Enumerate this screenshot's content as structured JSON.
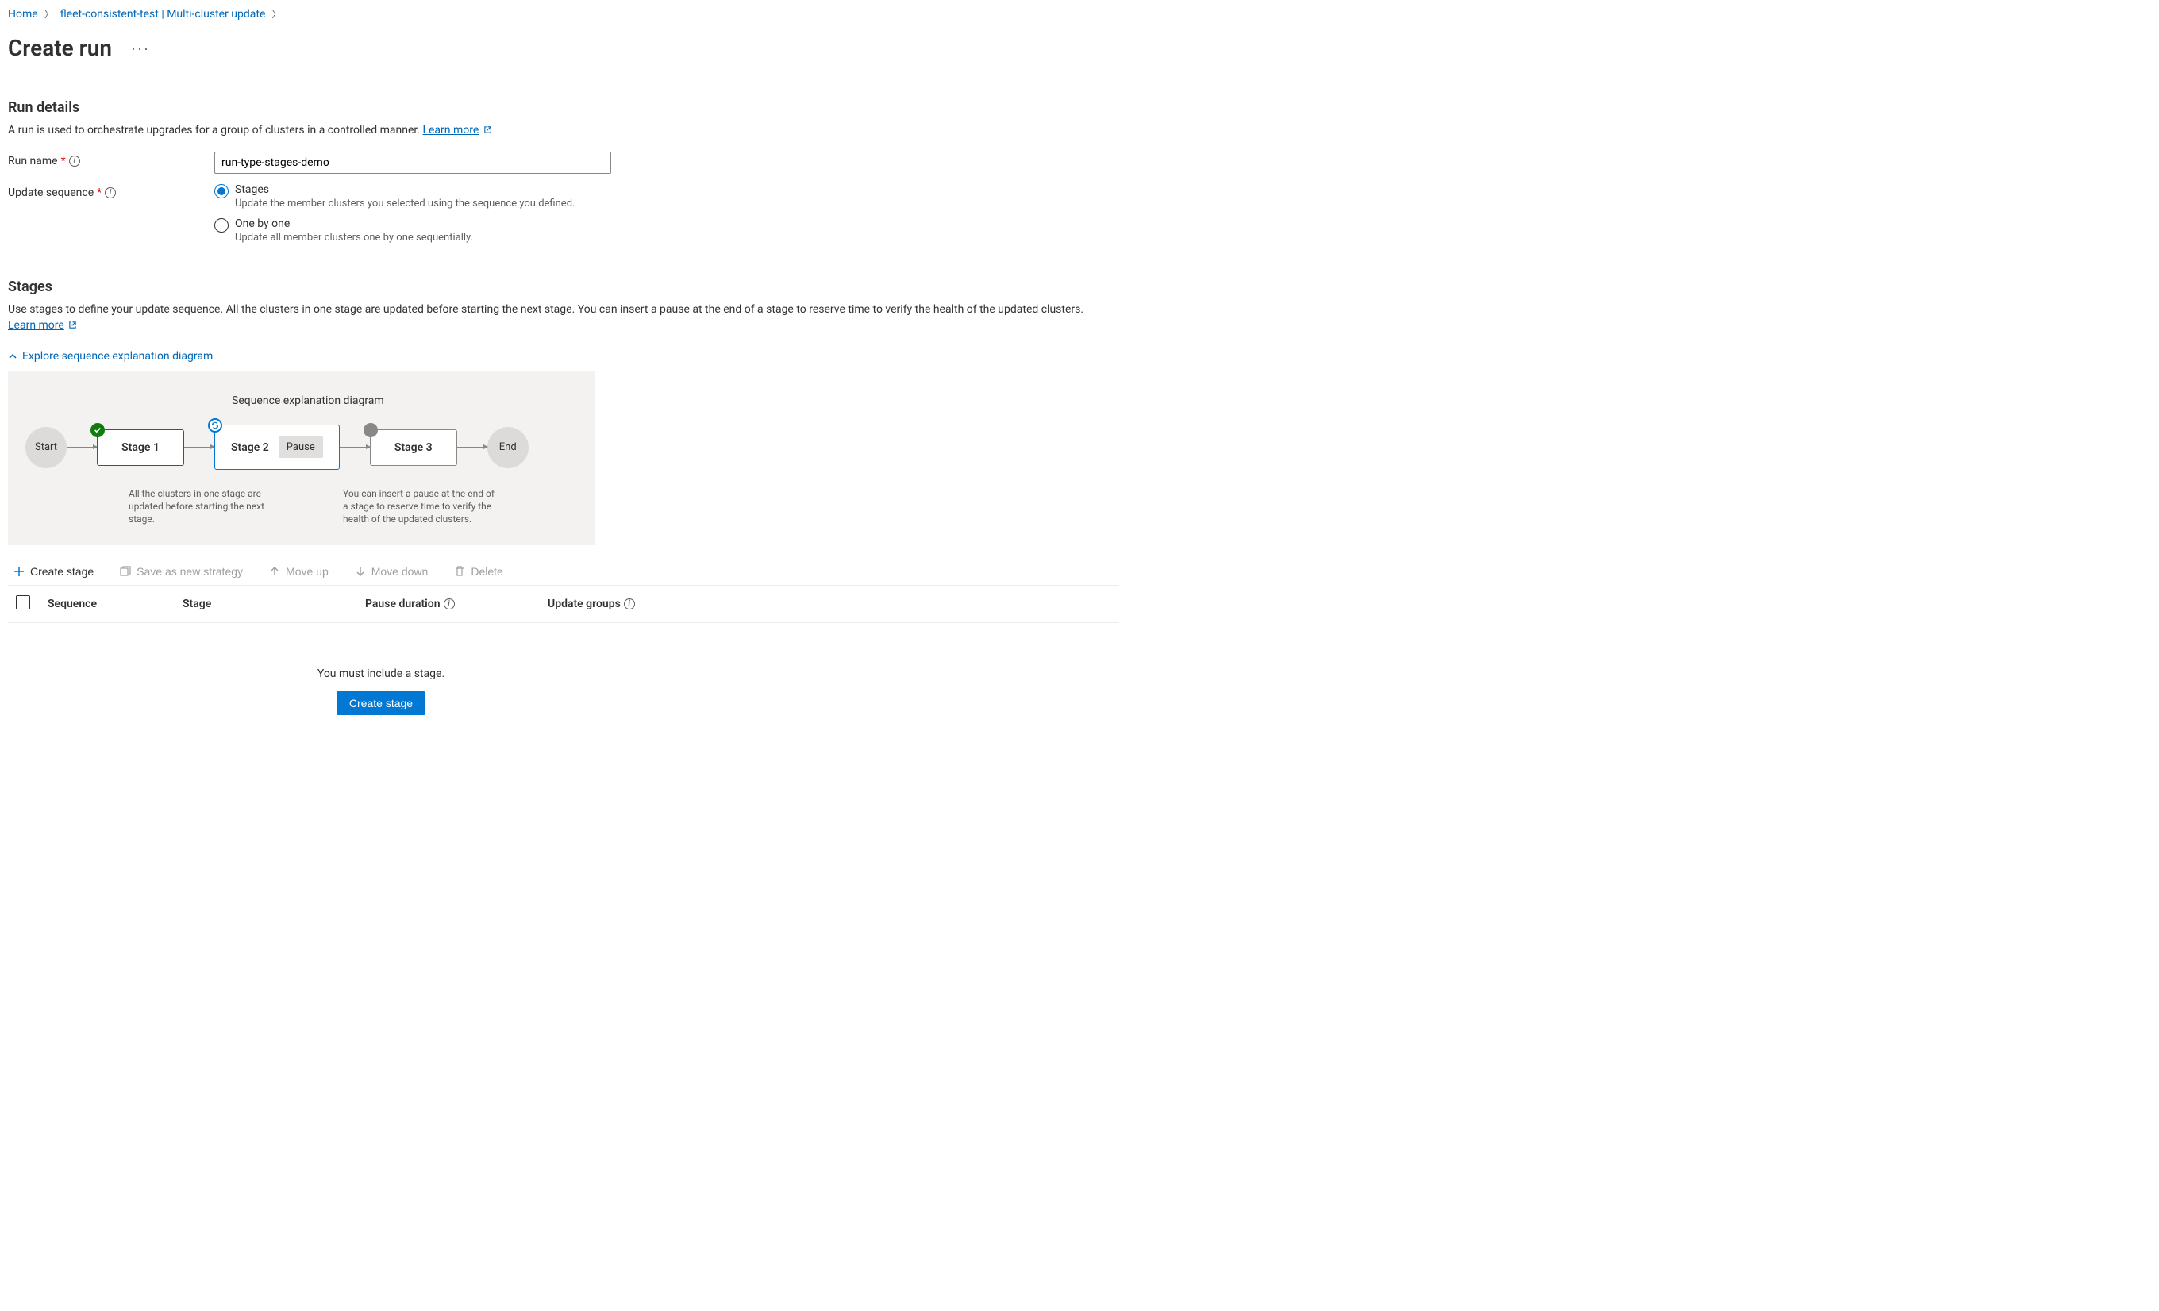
{
  "breadcrumb": {
    "home": "Home",
    "fleet": "fleet-consistent-test | Multi-cluster update"
  },
  "page": {
    "title": "Create run"
  },
  "runDetails": {
    "title": "Run details",
    "desc": "A run is used to orchestrate upgrades for a group of clusters in a controlled manner.",
    "learnMore": "Learn more",
    "runNameLabel": "Run name",
    "runNameValue": "run-type-stages-demo",
    "updateSeqLabel": "Update sequence",
    "options": {
      "stages": {
        "label": "Stages",
        "desc": "Update the member clusters you selected using the sequence you defined."
      },
      "oneByOne": {
        "label": "One by one",
        "desc": "Update all member clusters one by one sequentially."
      }
    }
  },
  "stages": {
    "title": "Stages",
    "desc": "Use stages to define your update sequence. All the clusters in one stage are updated before starting the next stage. You can insert a pause at the end of a stage to reserve time to verify the health of the updated clusters.",
    "learnMore": "Learn more",
    "explore": "Explore sequence explanation diagram",
    "diagram": {
      "title": "Sequence explanation diagram",
      "start": "Start",
      "stage1": "Stage 1",
      "stage2": "Stage 2",
      "pause": "Pause",
      "stage3": "Stage 3",
      "end": "End",
      "caption1": "All the clusters in one stage are updated before starting the next stage.",
      "caption2": "You can insert a pause at the end of a stage to reserve time to verify the health of the updated clusters."
    }
  },
  "toolbar": {
    "createStage": "Create stage",
    "saveAsNewStrategy": "Save as new strategy",
    "moveUp": "Move up",
    "moveDown": "Move down",
    "delete": "Delete"
  },
  "table": {
    "sequence": "Sequence",
    "stage": "Stage",
    "pauseDuration": "Pause duration",
    "updateGroups": "Update groups"
  },
  "empty": {
    "msg": "You must include a stage.",
    "cta": "Create stage"
  }
}
